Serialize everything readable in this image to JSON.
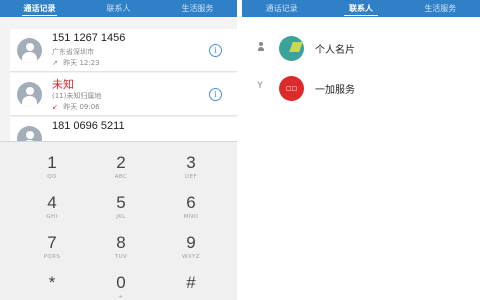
{
  "tabs": [
    "通话记录",
    "联系人",
    "生活服务"
  ],
  "calls": [
    {
      "name": "151 1267 1456",
      "location": "广东省深圳市",
      "direction": "↗",
      "time": "昨天 12:23",
      "missed": false
    },
    {
      "name": "未知",
      "location": "(11)未知归属地",
      "direction": "↙",
      "time": "昨天 09:06",
      "missed": true
    },
    {
      "name": "181 0696 5211",
      "location": "",
      "direction": "",
      "time": "",
      "missed": false
    }
  ],
  "info_icon_glyph": "i",
  "dialpad": [
    {
      "digit": "1",
      "letters": "QO"
    },
    {
      "digit": "2",
      "letters": "ABC"
    },
    {
      "digit": "3",
      "letters": "DEF"
    },
    {
      "digit": "4",
      "letters": "GHI"
    },
    {
      "digit": "5",
      "letters": "JKL"
    },
    {
      "digit": "6",
      "letters": "MNO"
    },
    {
      "digit": "7",
      "letters": "PQRS"
    },
    {
      "digit": "8",
      "letters": "TUV"
    },
    {
      "digit": "9",
      "letters": "WXYZ"
    },
    {
      "digit": "*",
      "letters": ""
    },
    {
      "digit": "0",
      "letters": "+"
    },
    {
      "digit": "#",
      "letters": ""
    }
  ],
  "contacts": [
    {
      "mark": "",
      "name": "个人名片",
      "avatar": "card-icon"
    },
    {
      "mark": "Y",
      "name": "一加服务",
      "avatar": "service-logo",
      "avatar_text": "□□"
    }
  ],
  "colors": {
    "accent": "#2f80c7",
    "missed": "#e02424",
    "info": "#4a90d9"
  }
}
